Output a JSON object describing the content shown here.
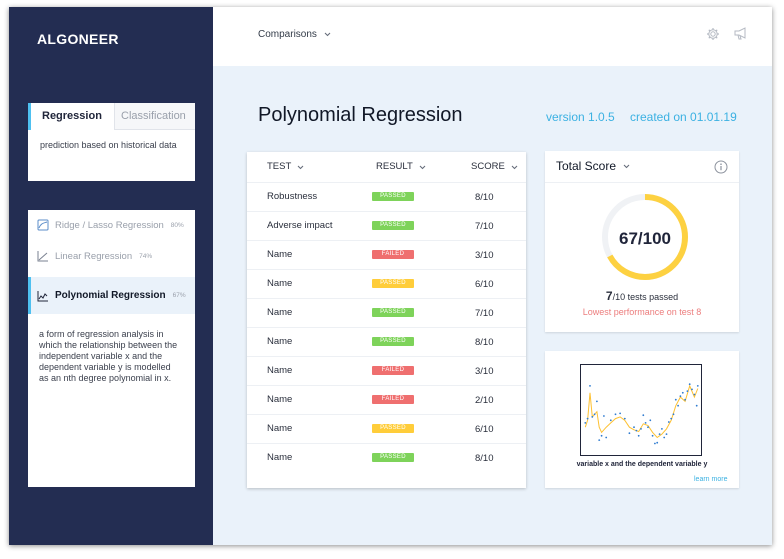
{
  "app": {
    "logo": "ALGONEER"
  },
  "header": {
    "dropdown_label": "Comparisons",
    "icons": [
      "gear-icon",
      "megaphone-icon"
    ]
  },
  "sidebar": {
    "tabs": [
      {
        "label": "Regression",
        "active": true
      },
      {
        "label": "Classification",
        "active": false
      }
    ],
    "tab_description": "prediction based on historical data",
    "algorithms": [
      {
        "label": "Ridge / Lasso Regression",
        "percent": "80%",
        "icon": "ridge-chart-icon",
        "active": false
      },
      {
        "label": "Linear Regression",
        "percent": "74%",
        "icon": "line-chart-icon",
        "active": false
      },
      {
        "label": "Polynomial Regression",
        "percent": "67%",
        "icon": "polynomial-chart-icon",
        "active": true
      }
    ],
    "algorithm_description": "a form of regression analysis in which the relationship between the independent variable x and the dependent variable y is modelled as an nth degree polynomial in x."
  },
  "main": {
    "title": "Polynomial Regression",
    "version": "version 1.0.5",
    "created": "created on 01.01.19"
  },
  "results_table": {
    "headers": {
      "test": "TEST",
      "result": "RESULT",
      "score": "SCORE"
    },
    "status_colors": {
      "PASSED": "#7ed35a",
      "FAILED": "#ef6f6f",
      "PASSED_WARN": "#ffcd3a"
    },
    "rows": [
      {
        "name": "Robustness",
        "result": "PASSED",
        "status": "PASSED",
        "score": "8/10"
      },
      {
        "name": "Adverse impact",
        "result": "PASSED",
        "status": "PASSED",
        "score": "7/10"
      },
      {
        "name": "Name",
        "result": "FAILED",
        "status": "FAILED",
        "score": "3/10"
      },
      {
        "name": "Name",
        "result": "PASSED",
        "status": "PASSED_WARN",
        "score": "6/10"
      },
      {
        "name": "Name",
        "result": "PASSED",
        "status": "PASSED",
        "score": "7/10"
      },
      {
        "name": "Name",
        "result": "PASSED",
        "status": "PASSED",
        "score": "8/10"
      },
      {
        "name": "Name",
        "result": "FAILED",
        "status": "FAILED",
        "score": "3/10"
      },
      {
        "name": "Name",
        "result": "FAILED",
        "status": "FAILED",
        "score": "2/10"
      },
      {
        "name": "Name",
        "result": "PASSED",
        "status": "PASSED_WARN",
        "score": "6/10"
      },
      {
        "name": "Name",
        "result": "PASSED",
        "status": "PASSED",
        "score": "8/10"
      }
    ]
  },
  "total_score": {
    "title": "Total Score",
    "display": "67/100",
    "value": 67,
    "max": 100,
    "tests_passed_count": "7",
    "tests_passed_suffix": "/10 tests passed",
    "lowest": "Lowest performance on test 8",
    "gauge_color": "#fdd141",
    "track_color": "#f0f2f5"
  },
  "plot": {
    "caption": "variable x and the dependent variable y",
    "learn_more": "learn more",
    "line_color": "#fdc132",
    "point_color": "#2e7bd0"
  },
  "chart_data": {
    "type": "scatter",
    "title": "",
    "xlabel": "variable x and the dependent variable y",
    "ylabel": "",
    "xlim": [
      0,
      100
    ],
    "ylim": [
      0,
      100
    ],
    "grid": false,
    "scatter_points": [
      [
        2,
        35
      ],
      [
        4,
        40
      ],
      [
        6,
        78
      ],
      [
        8,
        42
      ],
      [
        10,
        45
      ],
      [
        12,
        60
      ],
      [
        14,
        15
      ],
      [
        16,
        20
      ],
      [
        18,
        43
      ],
      [
        20,
        18
      ],
      [
        24,
        38
      ],
      [
        28,
        45
      ],
      [
        32,
        46
      ],
      [
        36,
        40
      ],
      [
        40,
        23
      ],
      [
        44,
        30
      ],
      [
        46,
        26
      ],
      [
        48,
        20
      ],
      [
        50,
        28
      ],
      [
        52,
        44
      ],
      [
        54,
        35
      ],
      [
        56,
        30
      ],
      [
        58,
        38
      ],
      [
        60,
        20
      ],
      [
        62,
        11
      ],
      [
        64,
        12
      ],
      [
        66,
        22
      ],
      [
        68,
        28
      ],
      [
        70,
        18
      ],
      [
        72,
        22
      ],
      [
        74,
        36
      ],
      [
        76,
        40
      ],
      [
        78,
        45
      ],
      [
        80,
        62
      ],
      [
        82,
        55
      ],
      [
        84,
        66
      ],
      [
        86,
        70
      ],
      [
        88,
        62
      ],
      [
        90,
        72
      ],
      [
        92,
        80
      ],
      [
        94,
        74
      ],
      [
        96,
        68
      ],
      [
        98,
        55
      ],
      [
        99,
        78
      ]
    ],
    "line": [
      [
        2,
        30
      ],
      [
        4,
        38
      ],
      [
        6,
        70
      ],
      [
        8,
        42
      ],
      [
        12,
        48
      ],
      [
        14,
        30
      ],
      [
        16,
        24
      ],
      [
        20,
        30
      ],
      [
        24,
        35
      ],
      [
        28,
        40
      ],
      [
        32,
        42
      ],
      [
        36,
        38
      ],
      [
        40,
        30
      ],
      [
        44,
        27
      ],
      [
        48,
        25
      ],
      [
        52,
        34
      ],
      [
        56,
        32
      ],
      [
        60,
        24
      ],
      [
        64,
        18
      ],
      [
        68,
        22
      ],
      [
        72,
        28
      ],
      [
        76,
        38
      ],
      [
        80,
        55
      ],
      [
        84,
        65
      ],
      [
        88,
        60
      ],
      [
        92,
        78
      ],
      [
        96,
        65
      ],
      [
        99,
        75
      ]
    ]
  }
}
